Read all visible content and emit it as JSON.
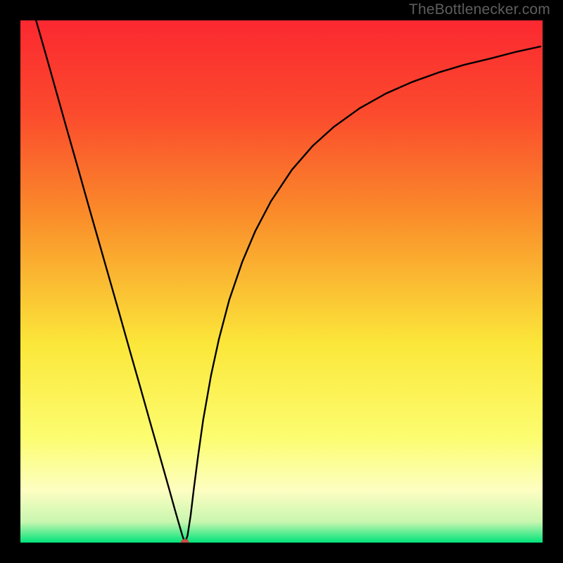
{
  "watermark": "TheBottlenecker.com",
  "chart_data": {
    "type": "line",
    "title": "",
    "xlabel": "",
    "ylabel": "",
    "xlim": [
      0,
      100
    ],
    "ylim": [
      0,
      100
    ],
    "grid": false,
    "legend": false,
    "background_gradient": {
      "top": "#fb2830",
      "mid_upper": "#fa8f2a",
      "mid": "#fbe73a",
      "mid_lower": "#fdfec1",
      "bottom": "#00e47a"
    },
    "marker": {
      "x": 31.5,
      "y": 0,
      "color": "#c74b44",
      "radius_px": 6
    },
    "x": [
      3,
      5,
      7,
      9,
      11,
      13,
      15,
      17,
      19,
      21,
      23,
      25,
      27,
      28.5,
      29.5,
      30.3,
      31,
      31.5,
      32,
      32.6,
      33.2,
      34,
      35,
      36.5,
      38,
      40,
      42.5,
      45,
      48,
      52,
      56,
      60,
      65,
      70,
      75,
      80,
      85,
      90,
      95,
      99.6
    ],
    "values": [
      100,
      93.0,
      85.9,
      78.8,
      71.8,
      64.7,
      57.7,
      50.7,
      43.7,
      36.6,
      29.6,
      22.5,
      15.5,
      10.2,
      6.6,
      3.8,
      1.4,
      0.0,
      1.3,
      5.2,
      10.2,
      16.4,
      23.5,
      32.0,
      38.9,
      46.5,
      53.8,
      59.7,
      65.4,
      71.4,
      76.0,
      79.6,
      83.2,
      86.0,
      88.2,
      90.0,
      91.5,
      92.7,
      94.0,
      95.0
    ]
  }
}
